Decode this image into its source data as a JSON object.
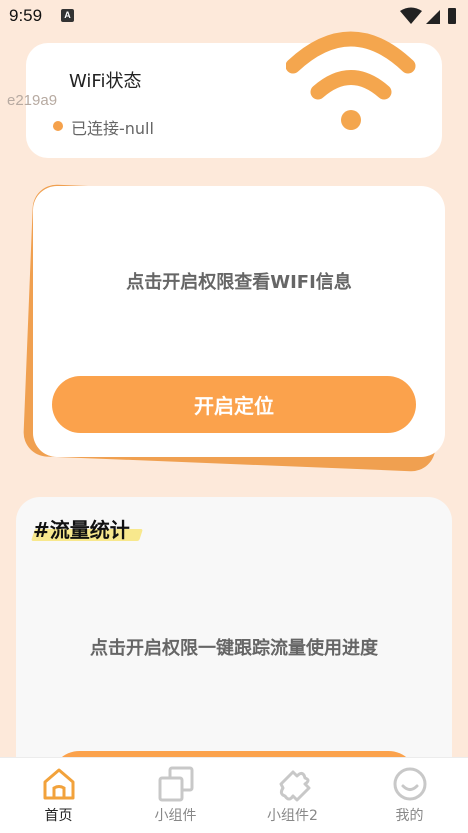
{
  "status_bar": {
    "time": "9:59",
    "notification_badge": "A"
  },
  "wifi_card": {
    "title": "WiFi状态",
    "status": "已连接-null"
  },
  "watermark": "e219a9",
  "permission_card": {
    "message": "点击开启权限查看WIFI信息",
    "button_label": "开启定位"
  },
  "traffic_card": {
    "title": "#流量统计",
    "message": "点击开启权限一键跟踪流量使用进度"
  },
  "tabbar": {
    "tabs": [
      {
        "label": "首页",
        "icon": "home-icon",
        "active": true
      },
      {
        "label": "小组件",
        "icon": "widgets-icon",
        "active": false
      },
      {
        "label": "小组件2",
        "icon": "puzzle-icon",
        "active": false
      },
      {
        "label": "我的",
        "icon": "profile-icon",
        "active": false
      }
    ]
  },
  "colors": {
    "accent": "#fba24c",
    "background": "#fde9da",
    "active_tab": "#f2a23b",
    "inactive_tab": "#c8c8c8"
  }
}
